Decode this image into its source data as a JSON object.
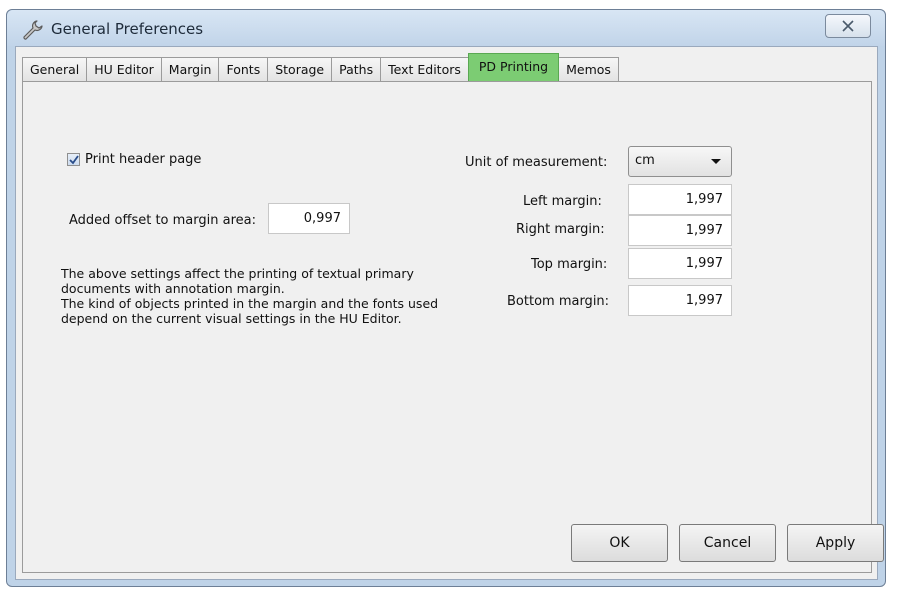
{
  "window": {
    "title": "General Preferences",
    "close_label": "☒"
  },
  "tabs": [
    {
      "label": "General"
    },
    {
      "label": "HU Editor"
    },
    {
      "label": "Margin"
    },
    {
      "label": "Fonts"
    },
    {
      "label": "Storage"
    },
    {
      "label": "Paths"
    },
    {
      "label": "Text Editors"
    },
    {
      "label": "PD Printing",
      "active": true
    },
    {
      "label": "Memos"
    }
  ],
  "pd_printing": {
    "print_header_label": "Print header page",
    "print_header_checked": true,
    "offset_label": "Added offset to margin area:",
    "offset_value": "0,997",
    "info_lines": [
      "The above settings affect the printing of textual primary",
      "documents with annotation margin.",
      "The kind of objects printed in the margin and the fonts used",
      "depend on the current visual settings in the HU Editor."
    ],
    "unit_label": "Unit of measurement:",
    "unit_value": "cm",
    "left_margin_label": "Left margin:",
    "left_margin_value": "1,997",
    "right_margin_label": "Right margin:",
    "right_margin_value": "1,997",
    "top_margin_label": "Top margin:",
    "top_margin_value": "1,997",
    "bottom_margin_label": "Bottom margin:",
    "bottom_margin_value": "1,997"
  },
  "buttons": {
    "ok": "OK",
    "cancel": "Cancel",
    "apply": "Apply"
  },
  "colors": {
    "active_tab": "#7ccc73",
    "window_frame": "#bfd3e8",
    "panel_bg": "#f0f0f0"
  }
}
